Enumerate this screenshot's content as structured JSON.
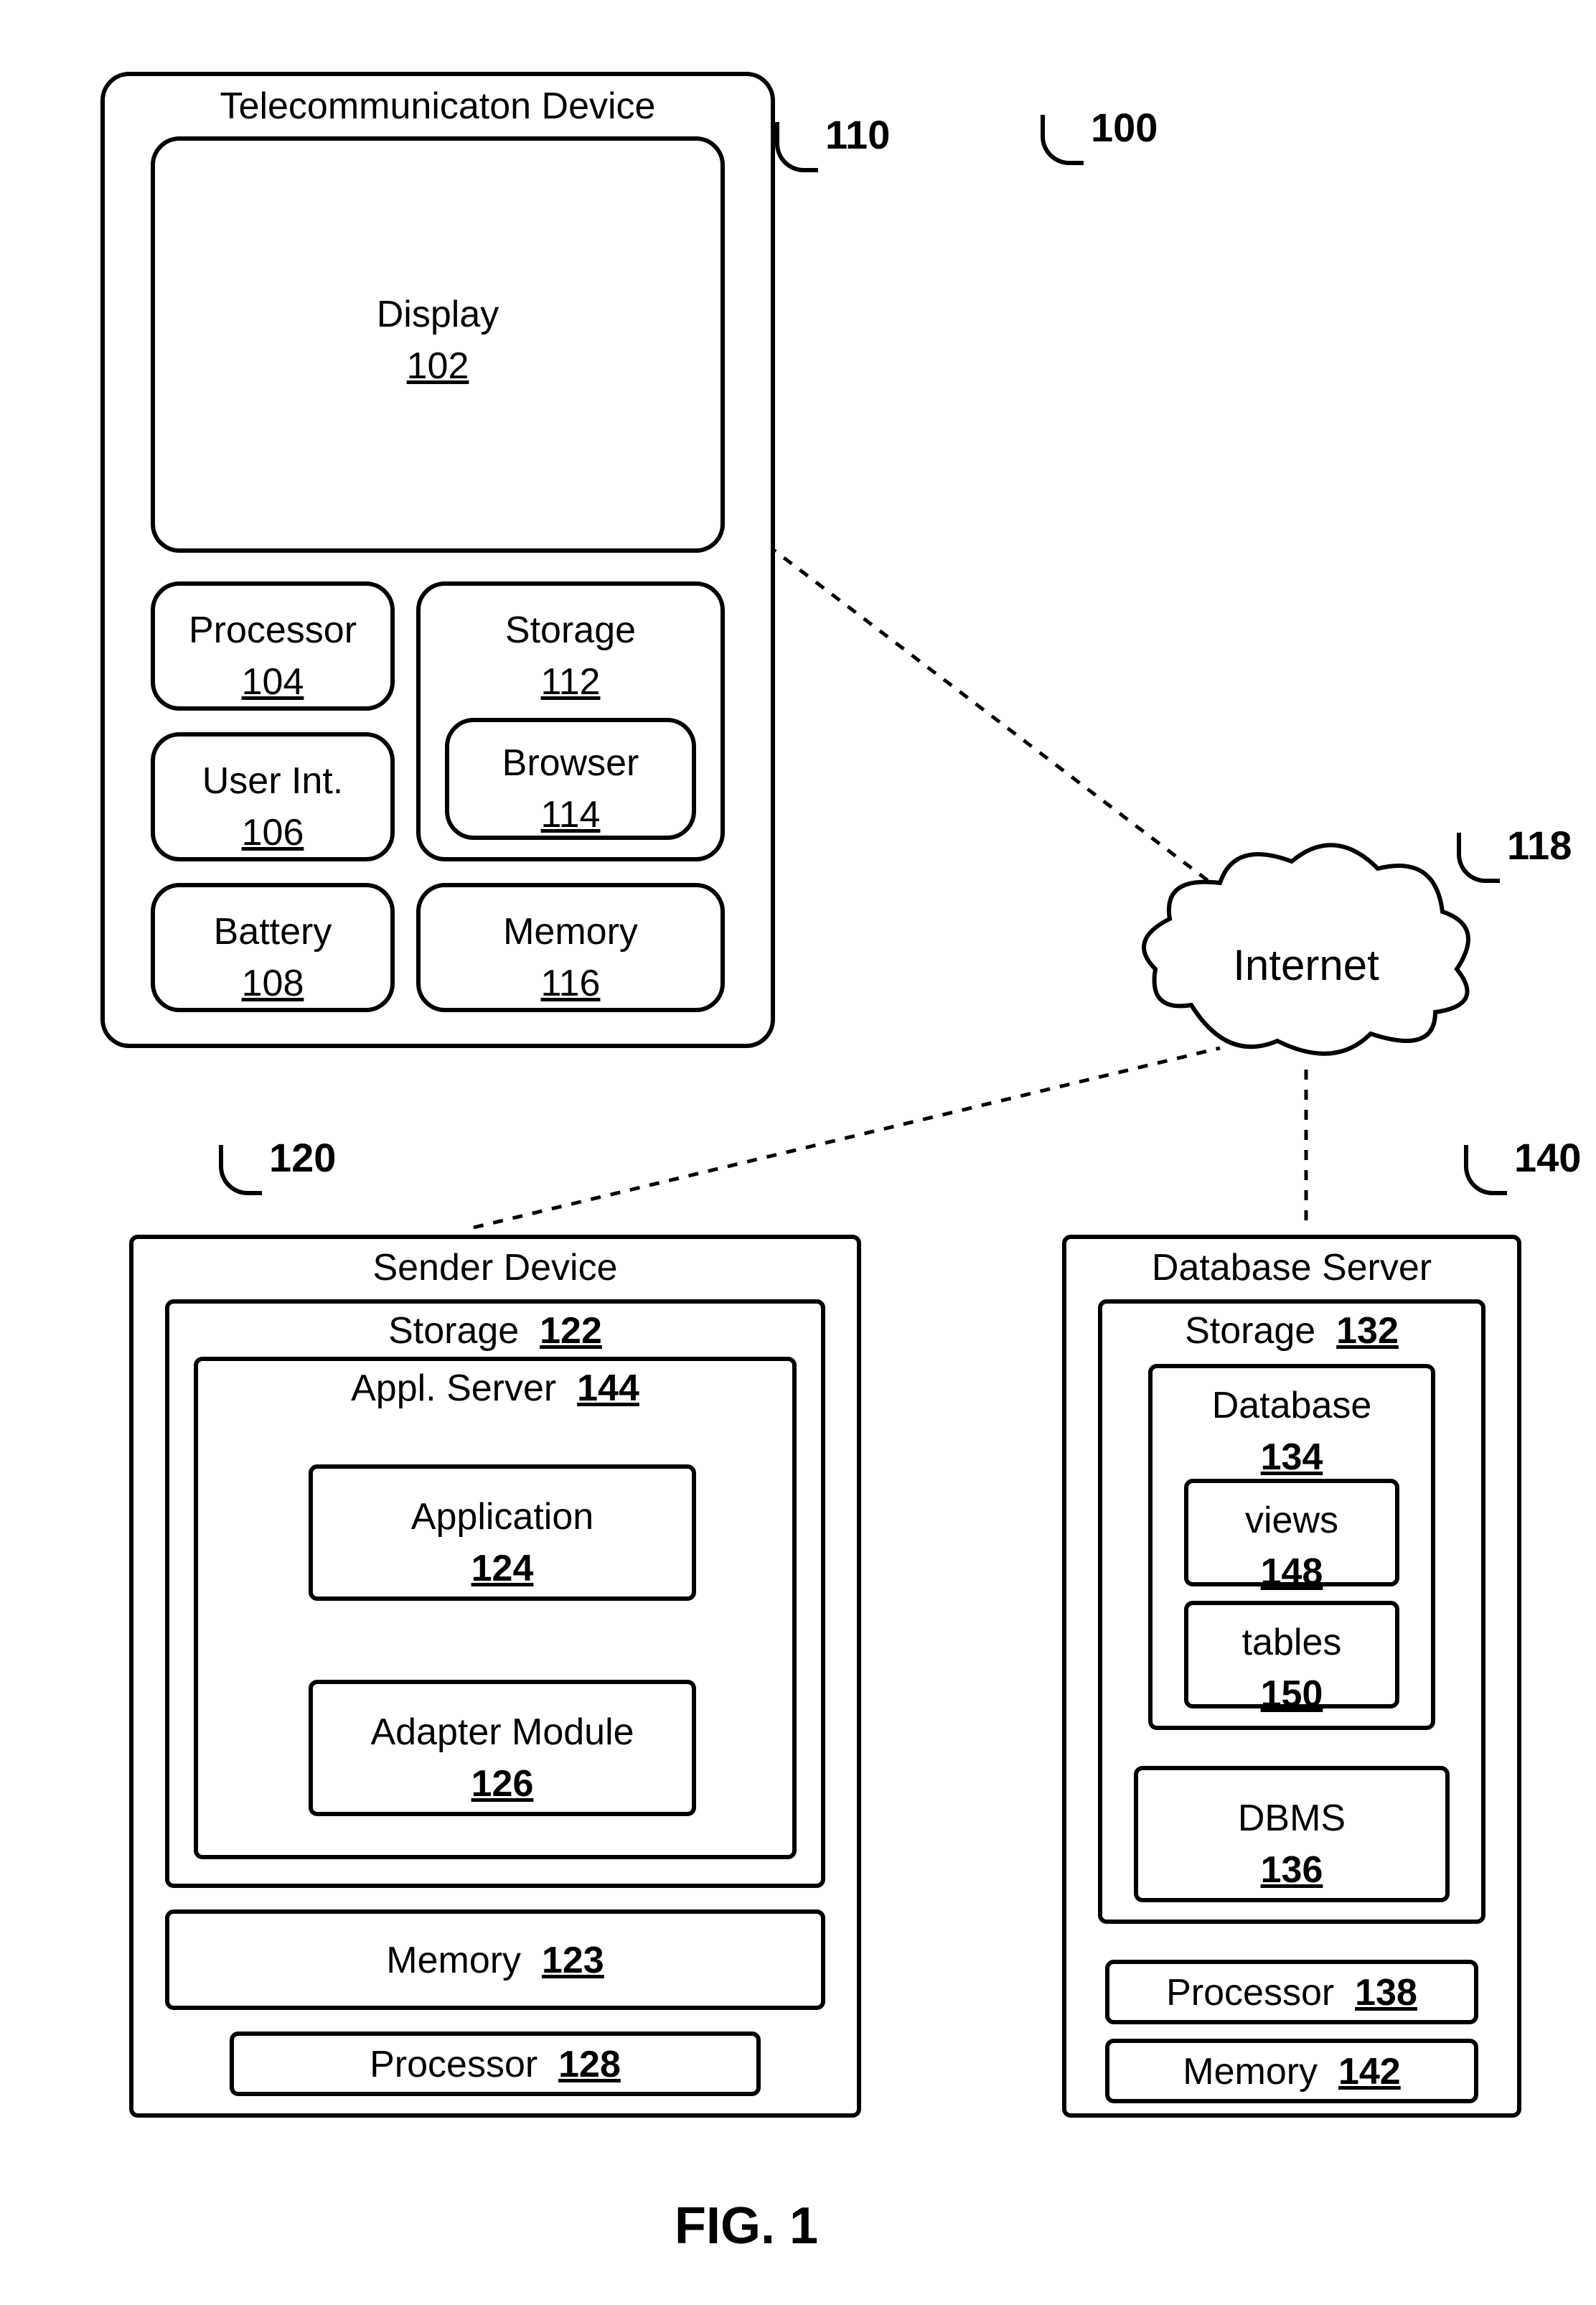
{
  "fig_caption": "FIG. 1",
  "refs": {
    "system": "100",
    "telecom_device": "110",
    "display": "102",
    "processor": "104",
    "user_int": "106",
    "battery": "108",
    "storage_td": "112",
    "browser": "114",
    "memory_td": "116",
    "internet": "118",
    "sender_device": "120",
    "storage_sd": "122",
    "memory_sd": "123",
    "application": "124",
    "adapter_module": "126",
    "processor_sd": "128",
    "storage_db": "132",
    "database": "134",
    "dbms": "136",
    "processor_db": "138",
    "db_server": "140",
    "memory_db": "142",
    "appl_server": "144",
    "views": "148",
    "tables": "150"
  },
  "labels": {
    "telecom_device": "Telecommunicaton Device",
    "display": "Display",
    "processor": "Processor",
    "user_int": "User Int.",
    "battery": "Battery",
    "storage": "Storage",
    "browser": "Browser",
    "memory": "Memory",
    "internet": "Internet",
    "sender_device": "Sender Device",
    "appl_server": "Appl. Server",
    "application": "Application",
    "adapter_module": "Adapter Module",
    "db_server": "Database Server",
    "database": "Database",
    "views": "views",
    "tables": "tables",
    "dbms": "DBMS"
  }
}
